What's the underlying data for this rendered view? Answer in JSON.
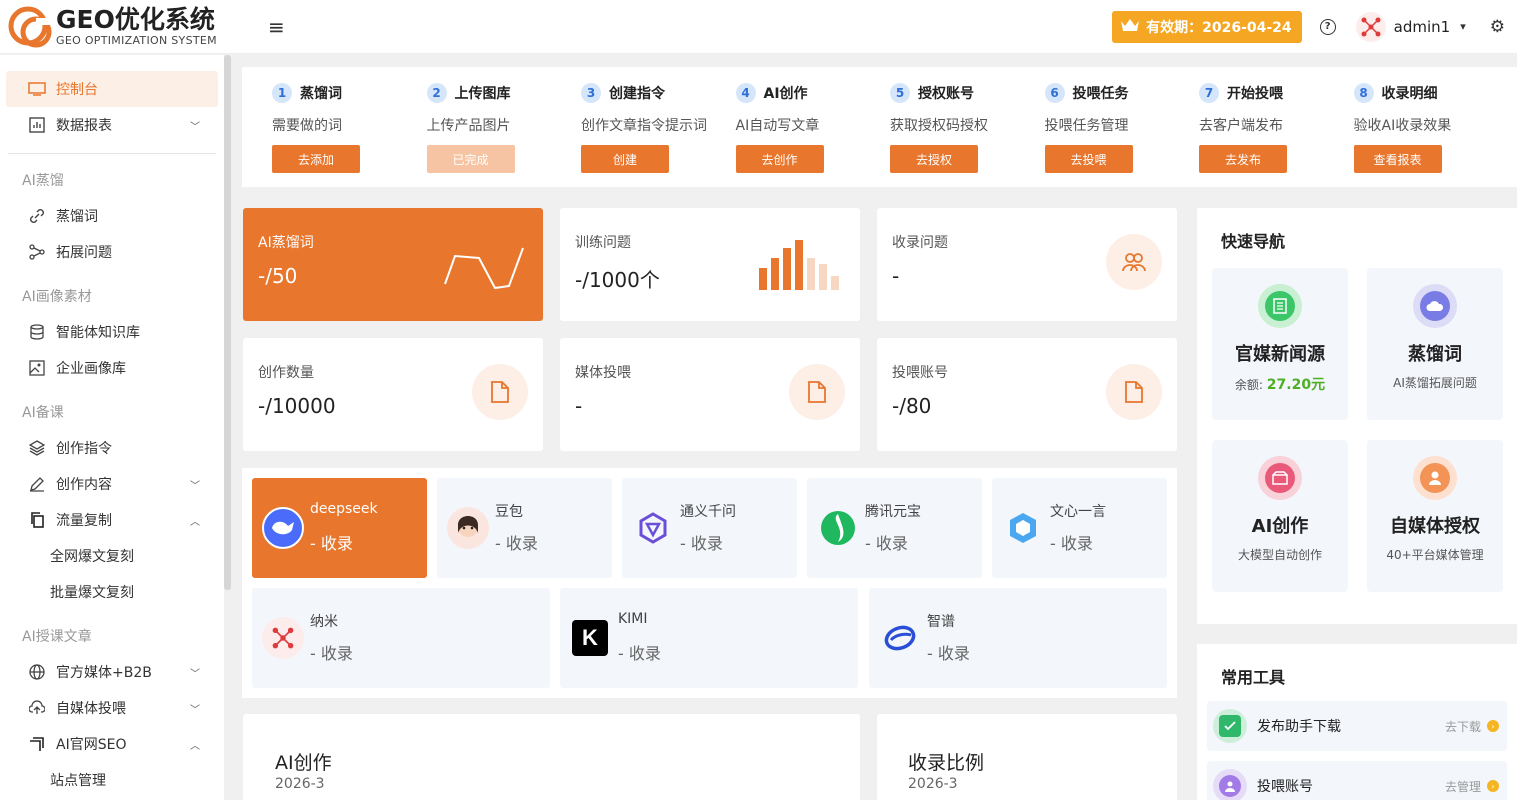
{
  "header": {
    "logo_title": "GEO优化系统",
    "logo_subtitle": "GEO OPTIMIZATION SYSTEM",
    "validity_label": "有效期：2026-04-24",
    "username": "admin1",
    "accent_color": "#e8762d"
  },
  "sidebar": {
    "items": [
      {
        "label": "控制台",
        "icon": "monitor-icon"
      },
      {
        "label": "数据报表",
        "icon": "chart-icon"
      }
    ],
    "group_ai_distill": "AI蒸馏",
    "distill_items": [
      {
        "label": "蒸馏词",
        "icon": "link-icon"
      },
      {
        "label": "拓展问题",
        "icon": "share-icon"
      }
    ],
    "group_ai_material": "AI画像素材",
    "material_items": [
      {
        "label": "智能体知识库",
        "icon": "database-icon"
      },
      {
        "label": "企业画像库",
        "icon": "image-icon"
      }
    ],
    "group_ai_prep": "AI备课",
    "prep_items": [
      {
        "label": "创作指令",
        "icon": "layers-icon"
      },
      {
        "label": "创作内容",
        "icon": "edit-icon"
      },
      {
        "label": "流量复制",
        "icon": "copy-icon"
      }
    ],
    "traffic_sub": [
      "全网爆文复刻",
      "批量爆文复刻"
    ],
    "group_ai_teach": "AI授课文章",
    "teach_items": [
      {
        "label": "官方媒体+B2B",
        "icon": "globe-icon"
      },
      {
        "label": "自媒体投喂",
        "icon": "upload-icon"
      },
      {
        "label": "AI官网SEO",
        "icon": "seo-icon"
      }
    ],
    "seo_sub": [
      "站点管理"
    ]
  },
  "steps": [
    {
      "num": "1",
      "title": "蒸馏词",
      "desc": "需要做的词",
      "button": "去添加",
      "done": false
    },
    {
      "num": "2",
      "title": "上传图库",
      "desc": "上传产品图片",
      "button": "已完成",
      "done": true
    },
    {
      "num": "3",
      "title": "创建指令",
      "desc": "创作文章指令提示词",
      "button": "创建",
      "done": false
    },
    {
      "num": "4",
      "title": "AI创作",
      "desc": "AI自动写文章",
      "button": "去创作",
      "done": false
    },
    {
      "num": "5",
      "title": "授权账号",
      "desc": "获取授权码授权",
      "button": "去授权",
      "done": false
    },
    {
      "num": "6",
      "title": "投喂任务",
      "desc": "投喂任务管理",
      "button": "去投喂",
      "done": false
    },
    {
      "num": "7",
      "title": "开始投喂",
      "desc": "去客户端发布",
      "button": "去发布",
      "done": false
    },
    {
      "num": "8",
      "title": "收录明细",
      "desc": "验收AI收录效果",
      "button": "查看报表",
      "done": false
    }
  ],
  "stats": {
    "distill": {
      "label": "AI蒸馏词",
      "value": "-/50"
    },
    "training": {
      "label": "训练问题",
      "value": "-/1000个"
    },
    "indexed": {
      "label": "收录问题",
      "value": "-"
    },
    "created": {
      "label": "创作数量",
      "value": "-/10000"
    },
    "media": {
      "label": "媒体投喂",
      "value": "-"
    },
    "accounts": {
      "label": "投喂账号",
      "value": "-/80"
    }
  },
  "platforms": [
    {
      "name": "deepseek",
      "value": "- 收录"
    },
    {
      "name": "豆包",
      "value": "- 收录"
    },
    {
      "name": "通义千问",
      "value": "- 收录"
    },
    {
      "name": "腾讯元宝",
      "value": "- 收录"
    },
    {
      "name": "文心一言",
      "value": "- 收录"
    },
    {
      "name": "纳米",
      "value": "- 收录"
    },
    {
      "name": "KIMI",
      "value": "- 收录"
    },
    {
      "name": "智谱",
      "value": "- 收录"
    }
  ],
  "ai_creation": {
    "title": "AI创作",
    "subtitle": "2026-3"
  },
  "index_ratio": {
    "title": "收录比例",
    "subtitle": "2026-3"
  },
  "quick_nav": {
    "title": "快速导航",
    "items": [
      {
        "title": "官媒新闻源",
        "sub_label": "余额:",
        "sub_value": "27.20元"
      },
      {
        "title": "蒸馏词",
        "sub": "AI蒸馏拓展问题"
      },
      {
        "title": "AI创作",
        "sub": "大模型自动创作"
      },
      {
        "title": "自媒体授权",
        "sub": "40+平台媒体管理"
      }
    ]
  },
  "tools": {
    "title": "常用工具",
    "items": [
      {
        "name": "发布助手下载",
        "action": "去下载"
      },
      {
        "name": "投喂账号",
        "action": "去管理"
      }
    ]
  }
}
